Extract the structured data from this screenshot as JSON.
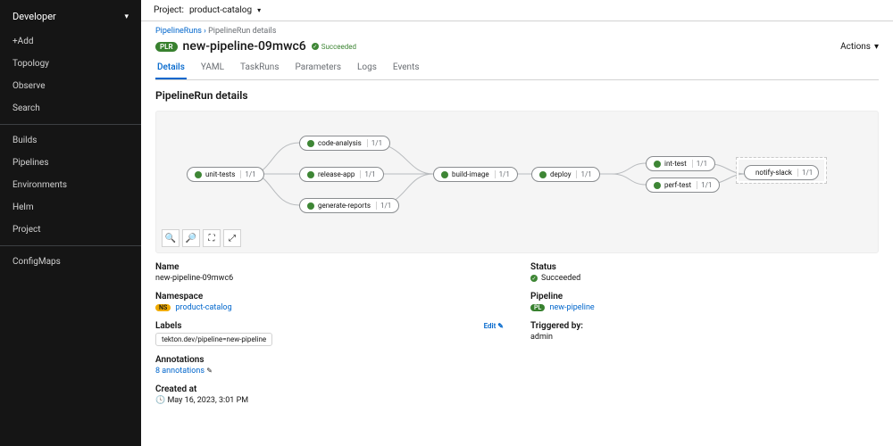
{
  "sidebar": {
    "perspective": "Developer",
    "items": [
      "+Add",
      "Topology",
      "Observe",
      "Search"
    ],
    "items2": [
      "Builds",
      "Pipelines",
      "Environments",
      "Helm",
      "Project"
    ],
    "items3": [
      "ConfigMaps"
    ]
  },
  "projectbar": {
    "label": "Project:",
    "value": "product-catalog"
  },
  "breadcrumb": {
    "root": "PipelineRuns",
    "current": "PipelineRun details"
  },
  "header": {
    "badge": "PLR",
    "title": "new-pipeline-09mwc6",
    "status": "Succeeded",
    "actions": "Actions"
  },
  "tabs": [
    "Details",
    "YAML",
    "TaskRuns",
    "Parameters",
    "Logs",
    "Events"
  ],
  "section_title": "PipelineRun details",
  "graph": {
    "nodes": {
      "unit": {
        "label": "unit-tests",
        "ratio": "1/1"
      },
      "code": {
        "label": "code-analysis",
        "ratio": "1/1"
      },
      "release": {
        "label": "release-app",
        "ratio": "1/1"
      },
      "reports": {
        "label": "generate-reports",
        "ratio": "1/1"
      },
      "build": {
        "label": "build-image",
        "ratio": "1/1"
      },
      "deploy": {
        "label": "deploy",
        "ratio": "1/1"
      },
      "inttest": {
        "label": "int-test",
        "ratio": "1/1"
      },
      "perftest": {
        "label": "perf-test",
        "ratio": "1/1"
      },
      "notify": {
        "label": "notify-slack",
        "ratio": "1/1"
      }
    }
  },
  "details_left": {
    "name_k": "Name",
    "name_v": "new-pipeline-09mwc6",
    "ns_k": "Namespace",
    "ns_badge": "NS",
    "ns_v": "product-catalog",
    "labels_k": "Labels",
    "edit": "Edit",
    "label_chip": "tekton.dev/pipeline=new-pipeline",
    "ann_k": "Annotations",
    "ann_v": "8 annotations",
    "created_k": "Created at",
    "created_v": "May 16, 2023, 3:01 PM"
  },
  "details_right": {
    "status_k": "Status",
    "status_v": "Succeeded",
    "pipe_k": "Pipeline",
    "pipe_badge": "PL",
    "pipe_v": "new-pipeline",
    "trig_k": "Triggered by:",
    "trig_v": "admin"
  }
}
